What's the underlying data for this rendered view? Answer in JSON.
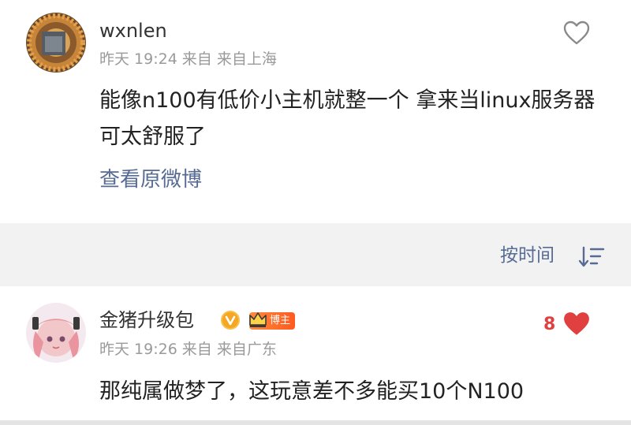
{
  "comment1": {
    "username": "wxnlen",
    "meta": [
      "昨天 19:24",
      "来自",
      "来自上海"
    ],
    "content": "能像n100有低价小主机就整一个 拿来当linux服务器可太舒服了",
    "view_original": "查看原微博"
  },
  "sort": {
    "label": "按时间"
  },
  "comment2": {
    "username": "金猪升级包",
    "badge": "博主",
    "meta": [
      "昨天 19:26",
      "来自",
      "来自广东"
    ],
    "content": "那纯属做梦了，这玩意差不多能买10个N100",
    "like_count": "8"
  },
  "colors": {
    "link": "#576b95",
    "like_active": "#e0403f",
    "divider": "#f2f2f2"
  }
}
